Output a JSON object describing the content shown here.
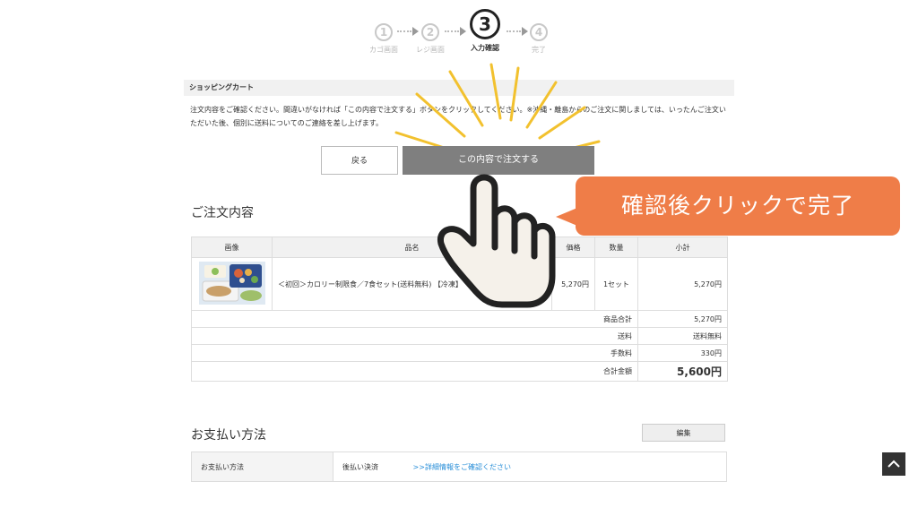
{
  "steps": [
    {
      "num": "1",
      "label": "カゴ画面"
    },
    {
      "num": "2",
      "label": "レジ画面"
    },
    {
      "num": "3",
      "label": "入力確認"
    },
    {
      "num": "4",
      "label": "完了"
    }
  ],
  "cart": {
    "title": "ショッピングカート",
    "notice": "注文内容をご確認ください。間違いがなければ「この内容で注文する」ボタンをクリックしてください。※沖縄・離島からのご注文に関しましては、いったんご注文いただいた後、個別に送料についてのご連絡を差し上げます。",
    "back_label": "戻る",
    "order_label": "この内容で注文する"
  },
  "callout": {
    "text": "確認後クリックで完了"
  },
  "order": {
    "heading": "ご注文内容",
    "columns": [
      "画像",
      "品名",
      "価格",
      "数量",
      "小計"
    ],
    "item": {
      "name": "＜初回＞カロリー制限食／7食セット(送料無料) 【冷凍】",
      "price": "5,270円",
      "qty": "1セット",
      "subtotal": "5,270円"
    },
    "summary": [
      {
        "label": "商品合計",
        "value": "5,270円"
      },
      {
        "label": "送料",
        "value": "送料無料"
      },
      {
        "label": "手数料",
        "value": "330円"
      },
      {
        "label": "合計金額",
        "value": "5,600円"
      }
    ]
  },
  "payment": {
    "heading": "お支払い方法",
    "edit_label": "編集",
    "key": "お支払い方法",
    "method": "後払い決済",
    "link": ">>詳細情報をご確認ください"
  },
  "colors": {
    "accent": "#ef7d48",
    "button": "#7f7f7f",
    "link": "#2a8fd8"
  },
  "icons": {
    "hand": "pointing-hand-icon",
    "to_top": "chevron-up-icon"
  }
}
